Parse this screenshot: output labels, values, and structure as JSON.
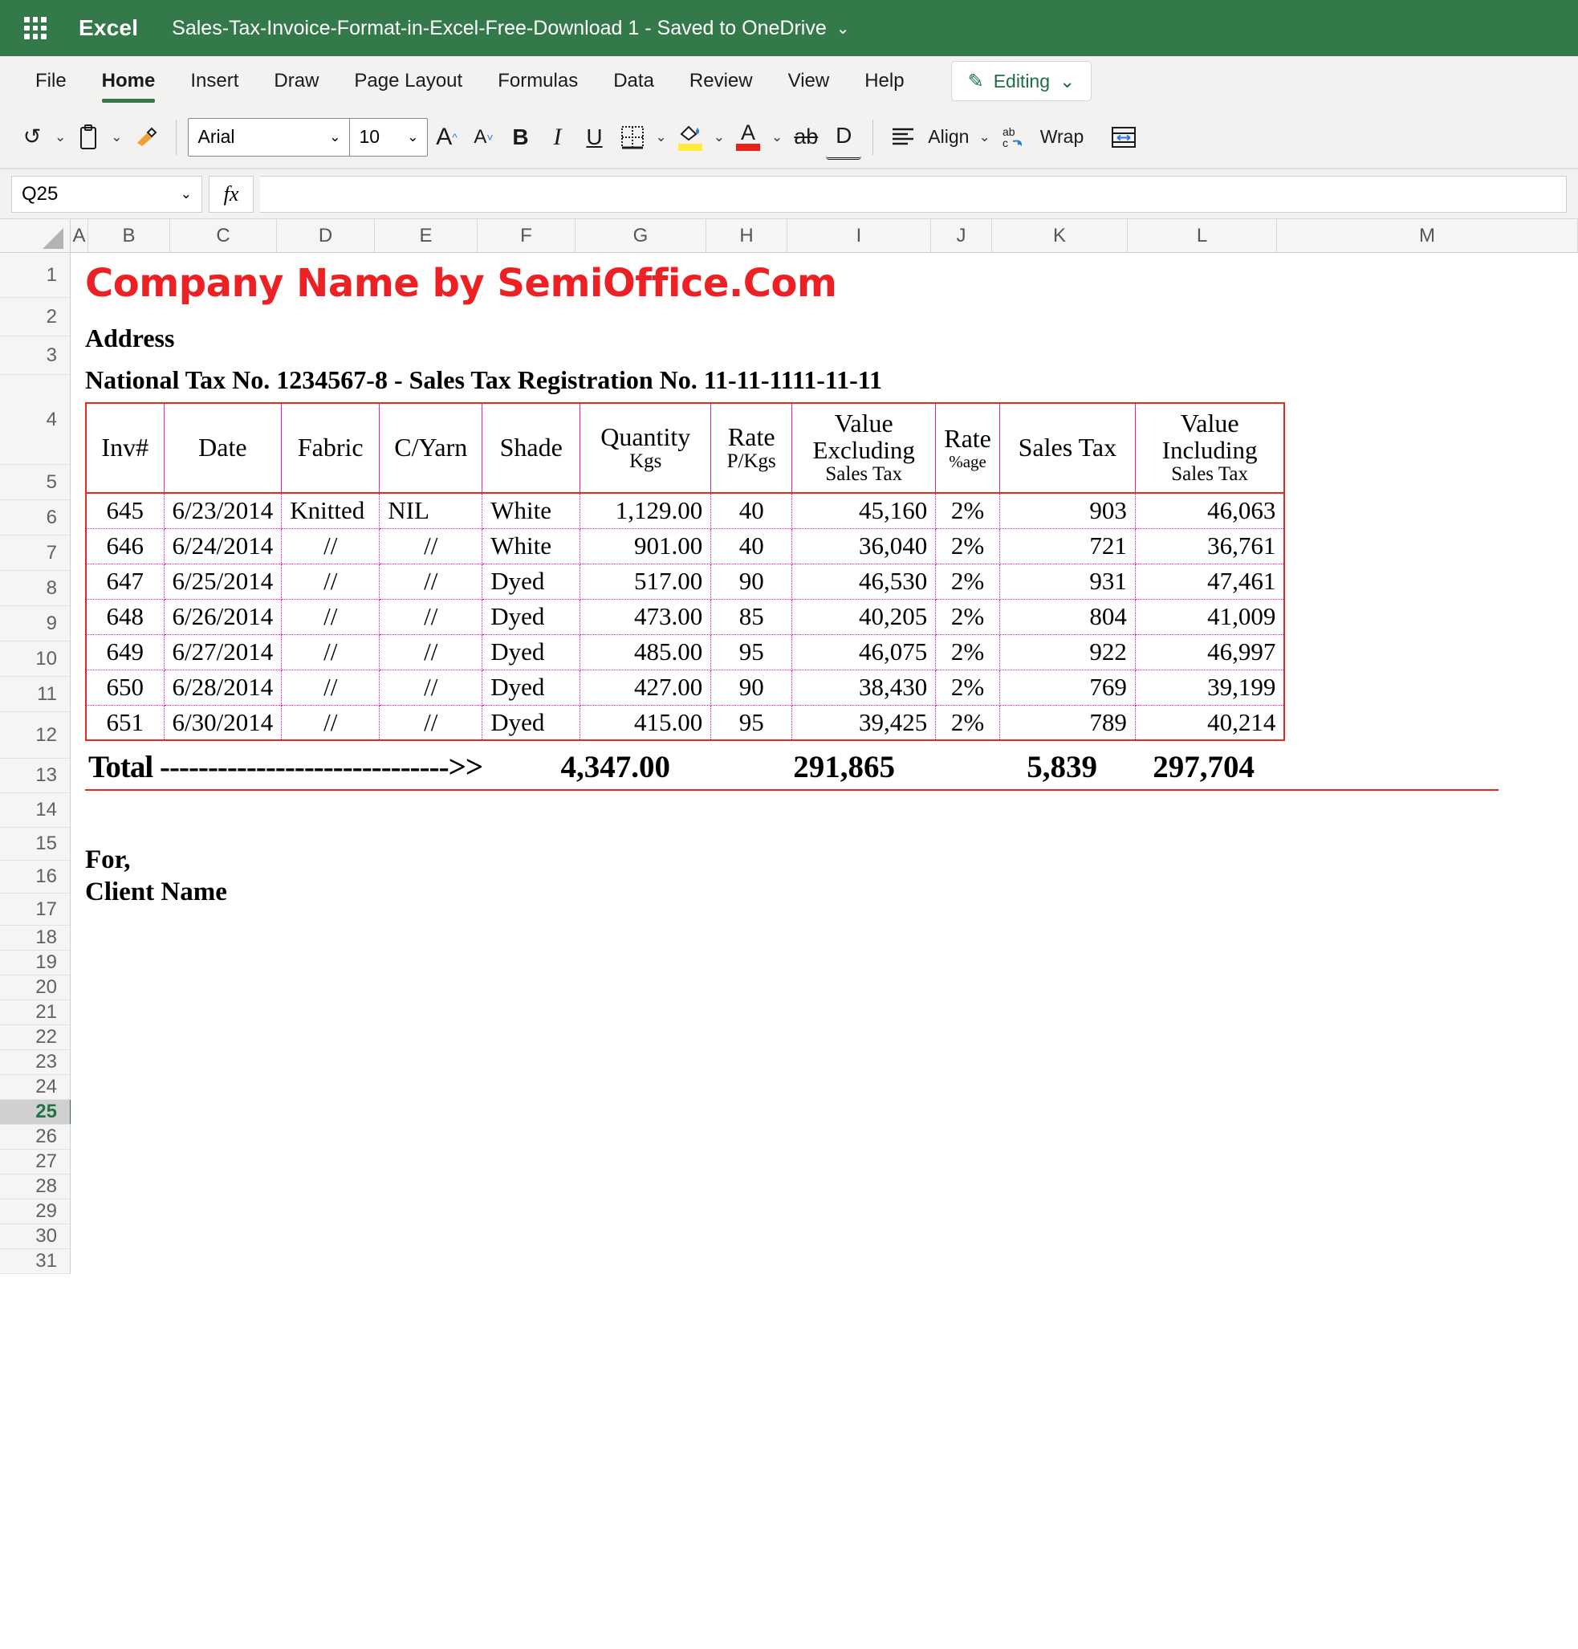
{
  "titlebar": {
    "app_name": "Excel",
    "doc_title": "Sales-Tax-Invoice-Format-in-Excel-Free-Download 1  -  Saved to OneDrive",
    "caret": "⌄",
    "waffle_icon": "app-launcher-icon"
  },
  "ribbon": {
    "tabs": [
      {
        "label": "File",
        "active": false
      },
      {
        "label": "Home",
        "active": true
      },
      {
        "label": "Insert",
        "active": false
      },
      {
        "label": "Draw",
        "active": false
      },
      {
        "label": "Page Layout",
        "active": false
      },
      {
        "label": "Formulas",
        "active": false
      },
      {
        "label": "Data",
        "active": false
      },
      {
        "label": "Review",
        "active": false
      },
      {
        "label": "View",
        "active": false
      },
      {
        "label": "Help",
        "active": false
      }
    ],
    "editing_label": "Editing",
    "editing_caret": "⌄"
  },
  "toolbar": {
    "undo": "↺",
    "paste": "clipboard-icon",
    "format_painter": "format-painter-icon",
    "font_name": "Arial",
    "font_size": "10",
    "grow_font": "A",
    "shrink_font": "A",
    "bold": "B",
    "italic": "I",
    "underline": "U",
    "borders": "borders-icon",
    "fill_color": "A",
    "font_color": "A",
    "strikethrough": "ab",
    "double_underline": "D",
    "align_label": "Align",
    "wrap_label": "Wrap",
    "autofit": "autofit-icon",
    "caret": "⌄"
  },
  "formula_bar": {
    "name_box": "Q25",
    "fx": "fx",
    "formula_value": "",
    "caret": "⌄"
  },
  "grid": {
    "columns": [
      "A",
      "B",
      "C",
      "D",
      "E",
      "F",
      "G",
      "H",
      "I",
      "J",
      "K",
      "L",
      "M"
    ],
    "rows": [
      "1",
      "2",
      "3",
      "4",
      "5",
      "6",
      "7",
      "8",
      "9",
      "10",
      "11",
      "12",
      "13",
      "14",
      "15",
      "16",
      "17",
      "18",
      "19",
      "20",
      "21",
      "22",
      "23",
      "24",
      "25",
      "26",
      "27",
      "28",
      "29",
      "30",
      "31"
    ],
    "selected_row": "25",
    "selected_cell": "Q25"
  },
  "invoice": {
    "company_name": "Company Name by SemiOffice.Com",
    "address": "Address",
    "tax_line": "National Tax No. 1234567-8   -   Sales Tax Registration No. 11-11-1111-11-11",
    "headers": [
      {
        "main": "Inv#",
        "sub": "",
        "sub2": ""
      },
      {
        "main": "Date",
        "sub": "",
        "sub2": ""
      },
      {
        "main": "Fabric",
        "sub": "",
        "sub2": ""
      },
      {
        "main": "C/Yarn",
        "sub": "",
        "sub2": ""
      },
      {
        "main": "Shade",
        "sub": "",
        "sub2": ""
      },
      {
        "main": "Quantity",
        "sub": "Kgs",
        "sub2": ""
      },
      {
        "main": "Rate",
        "sub": "P/Kgs",
        "sub2": ""
      },
      {
        "main": "Value",
        "sub": "Excluding",
        "sub2": "Sales Tax"
      },
      {
        "main": "Rate",
        "sub": "",
        "sub2": "%age"
      },
      {
        "main": "Sales Tax",
        "sub": "",
        "sub2": ""
      },
      {
        "main": "Value",
        "sub": "Including",
        "sub2": "Sales Tax"
      }
    ],
    "rows": [
      {
        "inv": "645",
        "date": "6/23/2014",
        "fabric": "Knitted",
        "cyarn": "NIL",
        "shade": "White",
        "qty": "1,129.00",
        "rate": "40",
        "value_ex": "45,160",
        "rate_pct": "2%",
        "sales_tax": "903",
        "value_inc": "46,063"
      },
      {
        "inv": "646",
        "date": "6/24/2014",
        "fabric": "//",
        "cyarn": "//",
        "shade": "White",
        "qty": "901.00",
        "rate": "40",
        "value_ex": "36,040",
        "rate_pct": "2%",
        "sales_tax": "721",
        "value_inc": "36,761"
      },
      {
        "inv": "647",
        "date": "6/25/2014",
        "fabric": "//",
        "cyarn": "//",
        "shade": "Dyed",
        "qty": "517.00",
        "rate": "90",
        "value_ex": "46,530",
        "rate_pct": "2%",
        "sales_tax": "931",
        "value_inc": "47,461"
      },
      {
        "inv": "648",
        "date": "6/26/2014",
        "fabric": "//",
        "cyarn": "//",
        "shade": "Dyed",
        "qty": "473.00",
        "rate": "85",
        "value_ex": "40,205",
        "rate_pct": "2%",
        "sales_tax": "804",
        "value_inc": "41,009"
      },
      {
        "inv": "649",
        "date": "6/27/2014",
        "fabric": "//",
        "cyarn": "//",
        "shade": "Dyed",
        "qty": "485.00",
        "rate": "95",
        "value_ex": "46,075",
        "rate_pct": "2%",
        "sales_tax": "922",
        "value_inc": "46,997"
      },
      {
        "inv": "650",
        "date": "6/28/2014",
        "fabric": "//",
        "cyarn": "//",
        "shade": "Dyed",
        "qty": "427.00",
        "rate": "90",
        "value_ex": "38,430",
        "rate_pct": "2%",
        "sales_tax": "769",
        "value_inc": "39,199"
      },
      {
        "inv": "651",
        "date": "6/30/2014",
        "fabric": "//",
        "cyarn": "//",
        "shade": "Dyed",
        "qty": "415.00",
        "rate": "95",
        "value_ex": "39,425",
        "rate_pct": "2%",
        "sales_tax": "789",
        "value_inc": "40,214"
      }
    ],
    "total": {
      "label": "Total ------------------------------>>",
      "qty": "4,347.00",
      "value_ex": "291,865",
      "sales_tax": "5,839",
      "value_inc": "297,704"
    },
    "footer": {
      "for": "For,",
      "client": "Client Name"
    },
    "colors": {
      "company_red": "#ed2024",
      "table_border_red": "#e8291c",
      "grid_magenta": "#e020c0",
      "excel_green": "#34794a",
      "editing_green": "#1d6f42"
    }
  }
}
